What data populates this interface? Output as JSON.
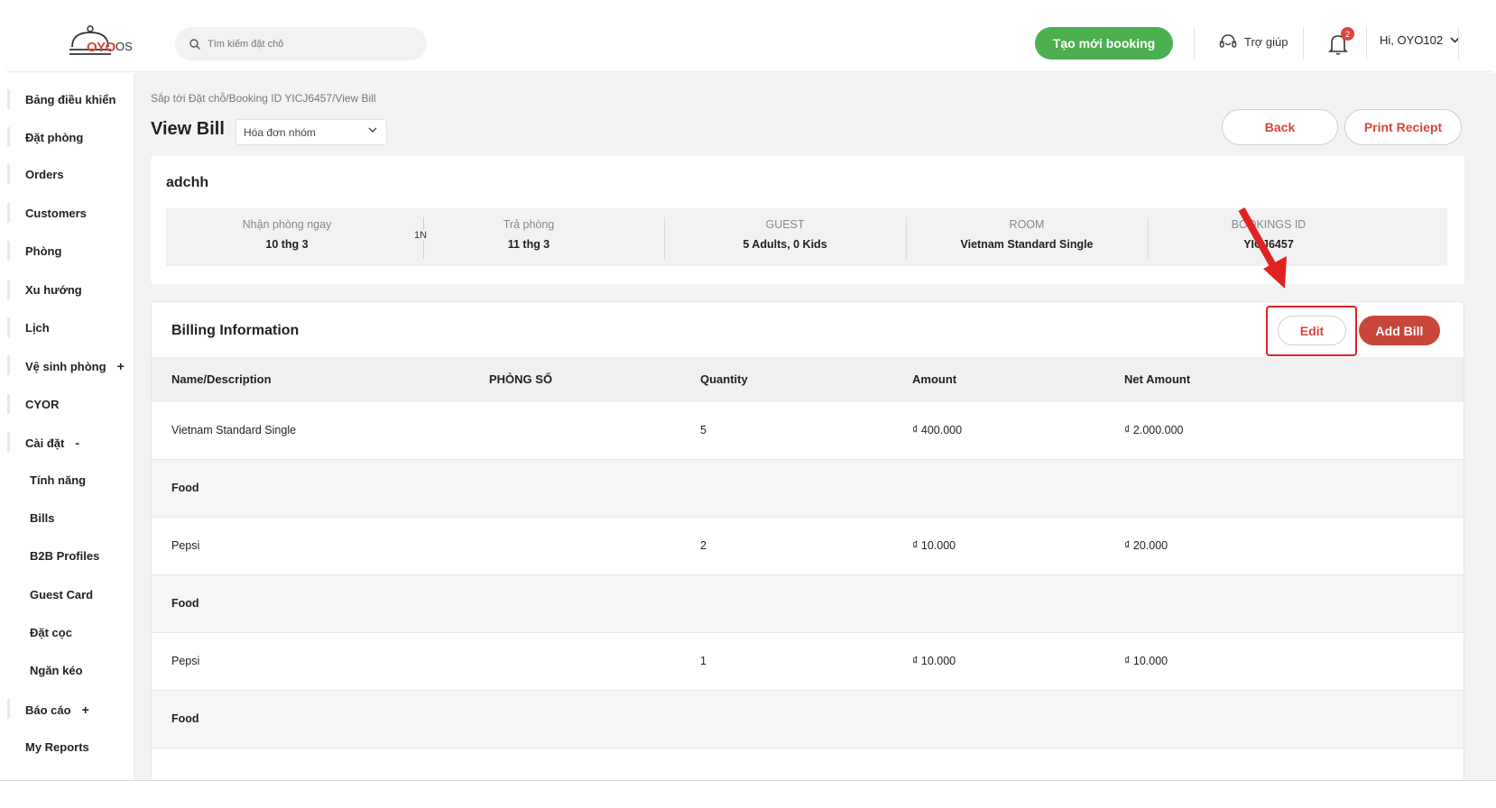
{
  "header": {
    "logo_text": "OYO",
    "logo_suffix": "OS",
    "search_placeholder": "Tìm kiếm đặt chỗ",
    "create_booking_label": "Tạo mới booking",
    "help_label": "Trợ giúp",
    "notification_count": "2",
    "user_greeting": "Hi, OYO102"
  },
  "sidebar": {
    "items": [
      {
        "label": "Bảng điều khiển"
      },
      {
        "label": "Đặt phòng"
      },
      {
        "label": "Orders"
      },
      {
        "label": "Customers"
      },
      {
        "label": "Phòng"
      },
      {
        "label": "Xu hướng"
      },
      {
        "label": "Lịch"
      },
      {
        "label": "Vệ sinh phòng",
        "sign": "+"
      },
      {
        "label": "CYOR"
      },
      {
        "label": "Cài đặt",
        "sign": "-"
      },
      {
        "label": "Tính năng"
      },
      {
        "label": "Bills"
      },
      {
        "label": "B2B Profiles"
      },
      {
        "label": "Guest Card"
      },
      {
        "label": "Đặt cọc"
      },
      {
        "label": "Ngăn kéo"
      },
      {
        "label": "Báo cáo",
        "sign": "+"
      },
      {
        "label": "My Reports"
      }
    ]
  },
  "page": {
    "breadcrumb": "Sắp tới Đặt chỗ/Booking ID YICJ6457/View Bill",
    "title": "View Bill",
    "bill_type_selected": "Hóa đơn nhóm",
    "back_label": "Back",
    "print_label": "Print Reciept"
  },
  "booking": {
    "guest_name": "adchh",
    "checkin_label": "Nhận phòng ngay",
    "checkin_value": "10 thg 3",
    "nights": "1N",
    "checkout_label": "Trả phòng",
    "checkout_value": "11 thg 3",
    "guest_label": "GUEST",
    "guest_value": "5 Adults, 0 Kids",
    "room_label": "ROOM",
    "room_value": "Vietnam Standard Single",
    "booking_id_label": "BOOKINGS ID",
    "booking_id_value": "YICJ6457"
  },
  "billing": {
    "title": "Billing Information",
    "edit_label": "Edit",
    "add_bill_label": "Add Bill",
    "columns": [
      "Name/Description",
      "PHÒNG SỐ",
      "Quantity",
      "Amount",
      "Net Amount"
    ],
    "rows": [
      {
        "name": "Vietnam Standard Single",
        "room": "",
        "quantity": "5",
        "amount": "₫ 400.000",
        "net": "₫ 2.000.000",
        "bold": false
      },
      {
        "name": "Food",
        "room": "",
        "quantity": "",
        "amount": "",
        "net": "",
        "bold": true
      },
      {
        "name": "Pepsi",
        "room": "",
        "quantity": "2",
        "amount": "₫ 10.000",
        "net": "₫ 20.000",
        "bold": false
      },
      {
        "name": "Food",
        "room": "",
        "quantity": "",
        "amount": "",
        "net": "",
        "bold": true
      },
      {
        "name": "Pepsi",
        "room": "",
        "quantity": "1",
        "amount": "₫ 10.000",
        "net": "₫ 10.000",
        "bold": false
      },
      {
        "name": "Food",
        "room": "",
        "quantity": "",
        "amount": "",
        "net": "",
        "bold": true
      }
    ]
  },
  "colors": {
    "brand_red": "#d8463a",
    "create_green": "#4caf50",
    "add_bill_red": "#c8473b",
    "highlight_red": "#e02222"
  }
}
